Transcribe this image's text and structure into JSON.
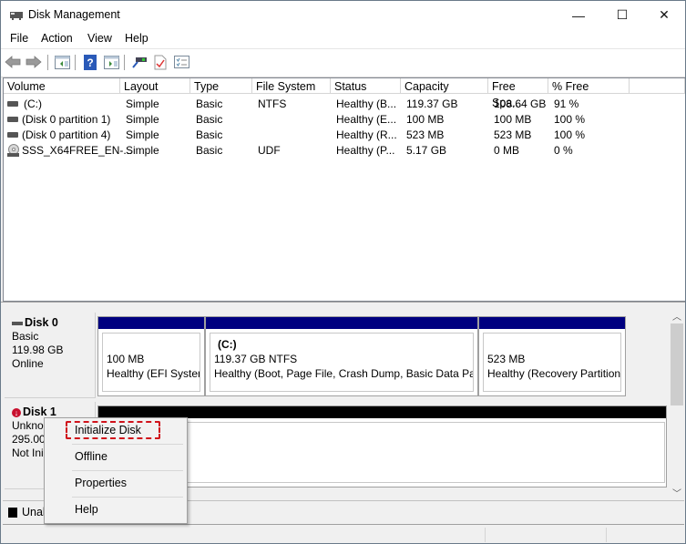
{
  "window": {
    "title": "Disk Management",
    "controls": {
      "minimize": "—",
      "maximize": "☐",
      "close": "✕"
    }
  },
  "menu": [
    "File",
    "Action",
    "View",
    "Help"
  ],
  "toolbar": {
    "icons": [
      "back-icon",
      "forward-icon",
      "show-hide-console-tree-icon",
      "help-icon",
      "show-hide-action-pane-icon",
      "connect-icon",
      "check-disk-icon",
      "properties-list-icon"
    ]
  },
  "volume_list": {
    "columns": [
      "Volume",
      "Layout",
      "Type",
      "File System",
      "Status",
      "Capacity",
      "Free Spa...",
      "% Free"
    ],
    "rows": [
      {
        "volume": "(C:)",
        "layout": "Simple",
        "type": "Basic",
        "fs": "NTFS",
        "status": "Healthy (B...",
        "capacity": "119.37 GB",
        "free": "108.64 GB",
        "pct": "91 %",
        "icon": "drive-icon"
      },
      {
        "volume": "(Disk 0 partition 1)",
        "layout": "Simple",
        "type": "Basic",
        "fs": "",
        "status": "Healthy (E...",
        "capacity": "100 MB",
        "free": "100 MB",
        "pct": "100 %",
        "icon": "drive-icon"
      },
      {
        "volume": "(Disk 0 partition 4)",
        "layout": "Simple",
        "type": "Basic",
        "fs": "",
        "status": "Healthy (R...",
        "capacity": "523 MB",
        "free": "523 MB",
        "pct": "100 %",
        "icon": "drive-icon"
      },
      {
        "volume": "SSS_X64FREE_EN-...",
        "layout": "Simple",
        "type": "Basic",
        "fs": "UDF",
        "status": "Healthy (P...",
        "capacity": "5.17 GB",
        "free": "0 MB",
        "pct": "0 %",
        "icon": "cd-drive-icon"
      }
    ]
  },
  "disks": [
    {
      "name": "Disk 0",
      "type": "Basic",
      "size": "119.98 GB",
      "state": "Online",
      "partitions": [
        {
          "title": "",
          "line1": "100 MB",
          "line2": "Healthy (EFI System"
        },
        {
          "title": "(C:)",
          "line1": "119.37 GB NTFS",
          "line2": "Healthy (Boot, Page File, Crash Dump, Basic Data Parti"
        },
        {
          "title": "",
          "line1": "523 MB",
          "line2": "Healthy (Recovery Partition)"
        }
      ]
    },
    {
      "name": "Disk 1",
      "type": "Unkno",
      "size": "295.00",
      "state": "Not Ini",
      "partitions": []
    }
  ],
  "legend": {
    "unallocated": "Unal"
  },
  "context_menu": {
    "items": [
      "Initialize Disk",
      "Offline",
      "Properties",
      "Help"
    ],
    "highlighted": "Initialize Disk"
  },
  "colors": {
    "partition_bar": "#000080",
    "unallocated_bar": "#000000",
    "highlight_border": "#d0121b"
  }
}
